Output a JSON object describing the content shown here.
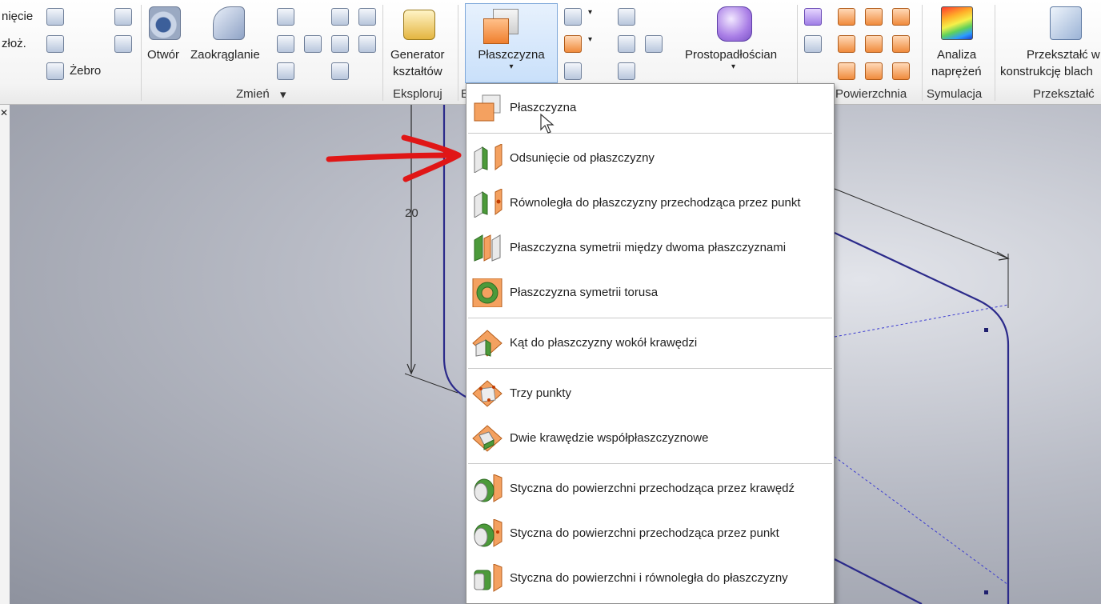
{
  "ribbon": {
    "partial_top_label": "nięcie",
    "partial_mid_label": "złoż.",
    "rib_label": "Żebro",
    "hole_label": "Otwór",
    "fillet_label": "Zaokrąglanie",
    "generator_line1": "Generator",
    "generator_line2": "kształtów",
    "plane_label": "Płaszczyzna",
    "box_label": "Prostopadłościan",
    "analysis_line1": "Analiza",
    "analysis_line2": "naprężeń",
    "convert_line1": "Przekształć w",
    "convert_line2": "konstrukcję blach",
    "groups": {
      "modify": "Zmień",
      "explore": "Eksploruj",
      "explore_partial": "E",
      "surface": "Powierzchnia",
      "simulation": "Symulacja",
      "convert": "Przekształć"
    }
  },
  "viewport": {
    "dimension_value": "20"
  },
  "plane_menu": {
    "items": [
      {
        "label": "Płaszczyzna",
        "icon": "plane-icon"
      },
      {
        "label": "Odsunięcie od płaszczyzny",
        "icon": "offset-plane-icon"
      },
      {
        "label": "Równoległa do płaszczyzny przechodząca przez punkt",
        "icon": "parallel-plane-point-icon"
      },
      {
        "label": "Płaszczyzna symetrii między dwoma płaszczyznami",
        "icon": "midplane-two-planes-icon"
      },
      {
        "label": "Płaszczyzna symetrii torusa",
        "icon": "torus-midplane-icon"
      },
      {
        "label": "Kąt do płaszczyzny wokół krawędzi",
        "icon": "angle-plane-edge-icon"
      },
      {
        "label": "Trzy punkty",
        "icon": "three-points-plane-icon"
      },
      {
        "label": "Dwie krawędzie współpłaszczyznowe",
        "icon": "two-coplanar-edges-icon"
      },
      {
        "label": "Styczna do powierzchni przechodząca przez krawędź",
        "icon": "tangent-surface-edge-icon"
      },
      {
        "label": "Styczna do powierzchni przechodząca przez punkt",
        "icon": "tangent-surface-point-icon"
      },
      {
        "label": "Styczna do powierzchni i równoległa do płaszczyzny",
        "icon": "tangent-surface-parallel-icon"
      }
    ]
  },
  "colors": {
    "accent_orange": "#f28c3c",
    "accent_green": "#4c9a3a",
    "sketch_line": "#2b2a8a",
    "arrow_red": "#e01616",
    "active_button": "#c9e0fa"
  }
}
